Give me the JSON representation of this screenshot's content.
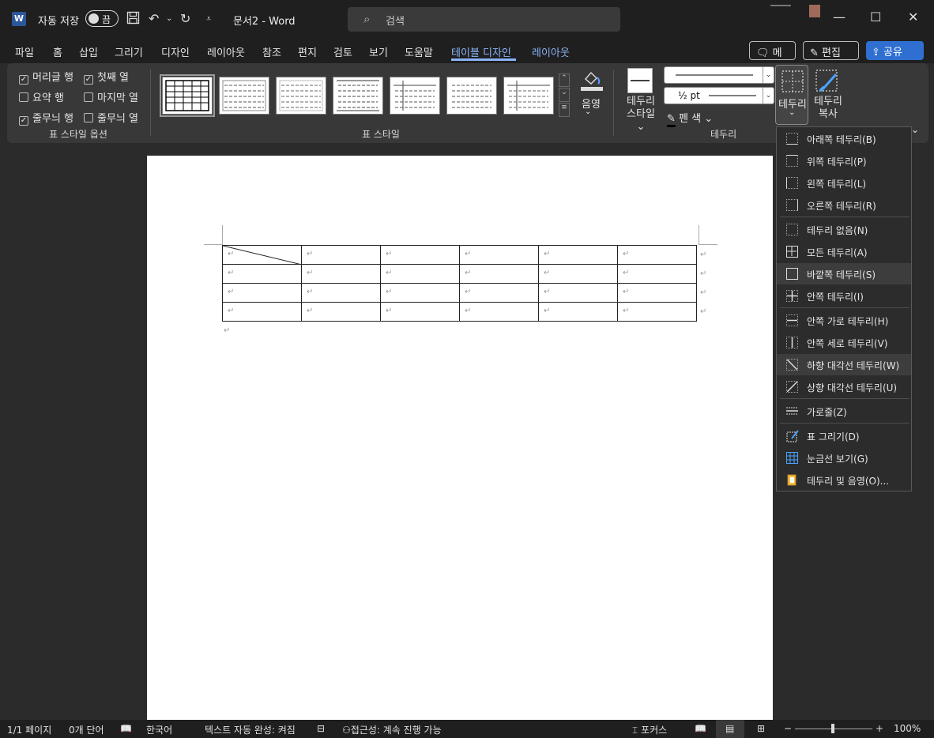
{
  "titlebar": {
    "app_icon": "word-icon",
    "autosave_label": "자동 저장",
    "autosave_state": "끔",
    "doc_title": "문서2  -  Word",
    "search_placeholder": "검색"
  },
  "tabs": [
    "파일",
    "홈",
    "삽입",
    "그리기",
    "디자인",
    "레이아웃",
    "참조",
    "편지",
    "검토",
    "보기",
    "도움말",
    "테이블 디자인",
    "레이아웃"
  ],
  "active_tab": "테이블 디자인",
  "tab_buttons": {
    "memo": "메모",
    "edit": "편집",
    "share": "공유"
  },
  "table_style_options": {
    "items": [
      {
        "label": "머리글 행",
        "checked": true
      },
      {
        "label": "첫째 열",
        "checked": true
      },
      {
        "label": "요약 행",
        "checked": false
      },
      {
        "label": "마지막 열",
        "checked": false
      },
      {
        "label": "줄무늬 행",
        "checked": true
      },
      {
        "label": "줄무늬 열",
        "checked": false
      }
    ],
    "group_label": "표 스타일 옵션"
  },
  "table_styles": {
    "group_label": "표 스타일",
    "shading": "음영"
  },
  "borders_group": {
    "border_styles": "테두리\n스타일",
    "border_styles_l1": "테두리",
    "border_styles_l2": "스타일",
    "line_weight": "½ pt",
    "pen_color": "펜 색",
    "borders": "테두리",
    "border_painter_l1": "테두리",
    "border_painter_l2": "복사",
    "group_label": "테두리"
  },
  "borders_menu": [
    {
      "label": "아래쪽 테두리(B)",
      "icon": "bottom-border-icon"
    },
    {
      "label": "위쪽 테두리(P)",
      "icon": "top-border-icon"
    },
    {
      "label": "왼쪽 테두리(L)",
      "icon": "left-border-icon"
    },
    {
      "label": "오른쪽 테두리(R)",
      "icon": "right-border-icon"
    },
    {
      "label": "테두리 없음(N)",
      "icon": "no-border-icon"
    },
    {
      "label": "모든 테두리(A)",
      "icon": "all-borders-icon"
    },
    {
      "label": "바깥쪽 테두리(S)",
      "icon": "outside-borders-icon"
    },
    {
      "label": "안쪽 테두리(I)",
      "icon": "inside-borders-icon"
    },
    {
      "label": "안쪽 가로 테두리(H)",
      "icon": "inside-horizontal-border-icon"
    },
    {
      "label": "안쪽 세로 테두리(V)",
      "icon": "inside-vertical-border-icon"
    },
    {
      "label": "하향 대각선 테두리(W)",
      "icon": "diagonal-down-border-icon"
    },
    {
      "label": "상향 대각선 테두리(U)",
      "icon": "diagonal-up-border-icon"
    },
    {
      "label": "가로줄(Z)",
      "icon": "horizontal-line-icon"
    },
    {
      "label": "표 그리기(D)",
      "icon": "draw-table-icon"
    },
    {
      "label": "눈금선 보기(G)",
      "icon": "view-gridlines-icon"
    },
    {
      "label": "테두리 및 음영(O)...",
      "icon": "borders-shading-icon"
    }
  ],
  "status": {
    "page": "1/1 페이지",
    "words": "0개 단어",
    "language": "한국어",
    "text_predictions": "텍스트 자동 완성: 켜짐",
    "accessibility": "접근성: 계속 진행 가능",
    "focus": "포커스",
    "zoom": "100%"
  }
}
